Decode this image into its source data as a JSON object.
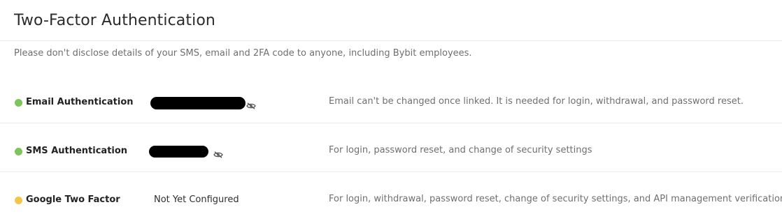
{
  "header": {
    "title": "Two-Factor Authentication",
    "notice": "Please don't disclose details of your SMS, email and 2FA code to anyone, including Bybit employees."
  },
  "colors": {
    "enabled_status": "#7dc45a",
    "pending_status": "#f5c54a",
    "redaction": "#000000"
  },
  "rows": [
    {
      "label": "Email Authentication",
      "status": "enabled",
      "value": "",
      "value_redacted": true,
      "visibility_icon": "eye-slash-icon",
      "description": "Email can't be changed once linked. It is needed for login, withdrawal, and password reset."
    },
    {
      "label": "SMS Authentication",
      "status": "enabled",
      "value": "",
      "value_redacted": true,
      "visibility_icon": "eye-slash-icon",
      "description": "For login, password reset, and change of security settings"
    },
    {
      "label": "Google Two Factor",
      "status": "pending",
      "value": "Not Yet Configured",
      "value_redacted": false,
      "description": "For login, withdrawal, password reset, change of security settings, and API management verification"
    }
  ]
}
